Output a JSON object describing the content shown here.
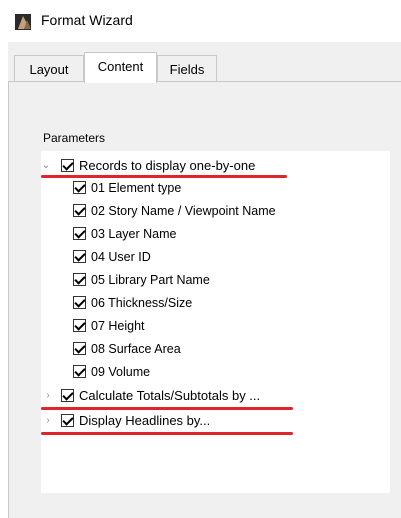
{
  "window": {
    "title": "Format Wizard"
  },
  "tabs": [
    {
      "label": "Layout",
      "active": false
    },
    {
      "label": "Content",
      "active": true
    },
    {
      "label": "Fields",
      "active": false
    }
  ],
  "content": {
    "section_label": "Parameters",
    "tree": {
      "records": {
        "label": "Records to display one-by-one",
        "checked": true,
        "expanded": true
      },
      "fields": [
        {
          "label": "01 Element type",
          "checked": true
        },
        {
          "label": "02 Story Name / Viewpoint Name",
          "checked": true
        },
        {
          "label": "03 Layer Name",
          "checked": true
        },
        {
          "label": "04 User ID",
          "checked": true
        },
        {
          "label": "05 Library Part Name",
          "checked": true
        },
        {
          "label": "06 Thickness/Size",
          "checked": true
        },
        {
          "label": "07 Height",
          "checked": true
        },
        {
          "label": "08 Surface Area",
          "checked": true
        },
        {
          "label": "09 Volume",
          "checked": true
        }
      ],
      "totals": {
        "label": "Calculate Totals/Subtotals by ...",
        "checked": true,
        "expanded": false
      },
      "headlines": {
        "label": "Display Headlines by...",
        "checked": true,
        "expanded": false
      }
    }
  },
  "annotation": {
    "underline_color": "#e0242b"
  },
  "icons": {
    "app": "app-logo-icon",
    "expanded": "chevron-down-icon",
    "collapsed": "chevron-right-icon",
    "checkbox": "checkbox-checked-icon"
  }
}
